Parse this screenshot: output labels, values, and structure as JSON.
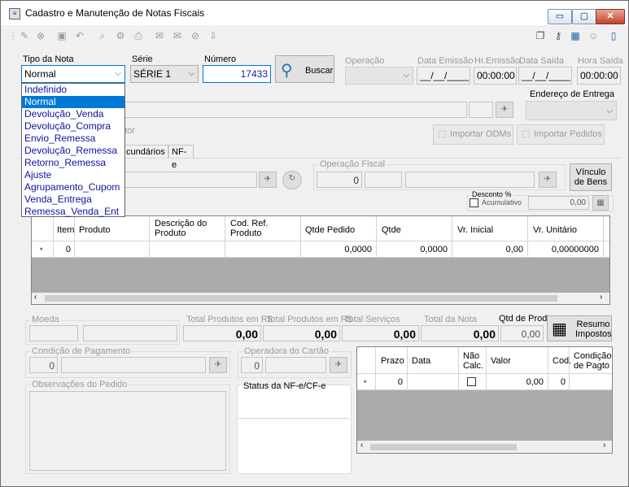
{
  "window": {
    "title": "Cadastro e Manutenção de Notas Fiscais",
    "min_label": "▭",
    "max_label": "▢",
    "close_label": "✕"
  },
  "toolbar": {
    "left_icons": [
      "edit-icon",
      "cancel-icon",
      "save-icon",
      "undo-icon",
      "zoom-icon",
      "network-icon",
      "print-icon",
      "mail-send-icon",
      "mail-icon",
      "block-icon",
      "export-icon"
    ],
    "right_icons": [
      "window-icon",
      "key-icon",
      "calendar-icon",
      "user-icon",
      "exit-icon"
    ]
  },
  "header": {
    "tipo_nota_label": "Tipo da Nota",
    "tipo_nota_value": "Normal",
    "serie_label": "Série",
    "serie_value": "SÉRIE 1",
    "numero_label": "Número",
    "numero_value": "17433",
    "buscar_label": "Buscar",
    "operacao_label": "Operação",
    "data_emissao_label": "Data Emissão",
    "data_emissao_value": "__/__/____",
    "hr_emissao_label": "Hr.Emissão",
    "hr_emissao_value": "00:00:00",
    "data_saida_label": "Data Saída",
    "data_saida_value": "__/__/____",
    "hora_saida_label": "Hora Saída",
    "hora_saida_value": "00:00:00"
  },
  "dropdown_options": [
    "Indefinido",
    "Normal",
    "Devolução_Venda",
    "Devolução_Compra",
    "Envio_Remessa",
    "Devolução_Remessa",
    "Retorno_Remessa",
    "Ajuste",
    "Agrupamento_Cupom",
    "Venda_Entrega",
    "Remessa_Venda_Ent"
  ],
  "selected_option": "Normal",
  "client": {
    "endereco_label": "Endereço de Entrega",
    "vendedor_fragment": "tor",
    "importar_odms": "Importar ODMs",
    "importar_pedidos": "Importar Pedidos"
  },
  "tabs": {
    "secundarios": "cundários",
    "nfe": "NF-e"
  },
  "fiscal": {
    "operacao_fiscal_label": "Operação Fiscal",
    "operacao_fiscal_value": "0",
    "vinculo_label": "Vínculo de Bens",
    "desconto_label": "Desconto %",
    "acumulativo_label": "Acumulativo",
    "desconto_value": "0,00"
  },
  "items_grid": {
    "columns": [
      "Item",
      "Produto",
      "Descrição do Produto",
      "Cod. Ref. Produto",
      "Qtde Pedido",
      "Qtde",
      "Vr. Inicial",
      "Vr. Unitário"
    ],
    "new_row": {
      "marker": "*",
      "item": "0",
      "qtde_pedido": "0,0000",
      "qtde": "0,0000",
      "vr_inicial": "0,00",
      "vr_unitario": "0,00000000"
    }
  },
  "totals": {
    "moeda_label": "Moeda",
    "total_produtos_label": "Total Produtos em R$",
    "total_produtos_value": "0,00",
    "total_produtos2_label": "Total Produtos em R$",
    "total_produtos2_value": "0,00",
    "total_servicos_label": "Total Serviços",
    "total_servicos_value": "0,00",
    "total_nota_label": "Total da Nota",
    "total_nota_value": "0,00",
    "qtd_prod_label": "Qtd de Prod.",
    "qtd_prod_value": "0,00",
    "resumo_label": "Resumo Impostos"
  },
  "payment": {
    "condicao_label": "Condição de Pagamento",
    "condicao_value": "0",
    "operadora_label": "Operadora do Cartão",
    "operadora_value": "0"
  },
  "observacoes_label": "Observações do Pedido",
  "status_label": "Status da NF-e/CF-e",
  "parcelas_grid": {
    "columns": [
      "Prazo",
      "Data",
      "Não Calc.",
      "Valor",
      "Cod.",
      "Condição de Pagto"
    ],
    "new_row": {
      "marker": "*",
      "prazo": "0",
      "valor": "0,00",
      "cod": "0"
    }
  }
}
